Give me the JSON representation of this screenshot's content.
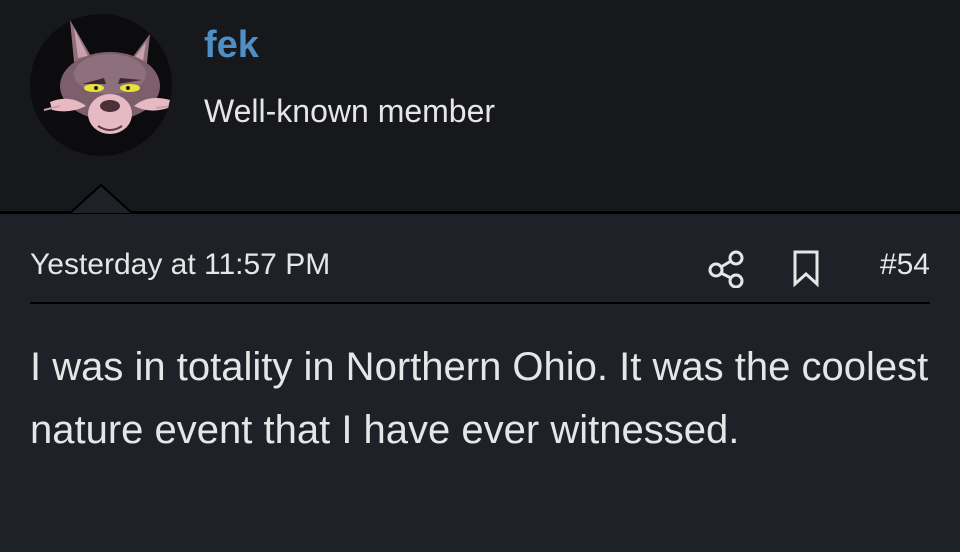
{
  "user": {
    "name": "fek",
    "title": "Well-known member",
    "avatar_icon": "coyote-avatar-icon"
  },
  "post": {
    "timestamp": "Yesterday at 11:57 PM",
    "number": "#54",
    "body": "I was in totality in Northern Ohio. It was the coolest nature event that I have ever witnessed."
  },
  "icons": {
    "share": "share-icon",
    "bookmark": "bookmark-icon"
  },
  "colors": {
    "username": "#4f8fc6",
    "background": "#1f2128",
    "header_background": "#17181c",
    "text": "#e6e6e6"
  }
}
